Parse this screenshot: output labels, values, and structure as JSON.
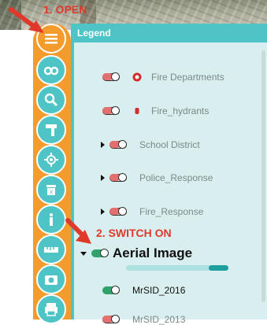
{
  "annotations": {
    "step1": "1. OPEN",
    "step2": "2. SWITCH ON"
  },
  "legend": {
    "title": "Legend",
    "layers": [
      {
        "label": "Fire Departments",
        "state": "off",
        "icon": "fire-dept-icon"
      },
      {
        "label": "Fire_hydrants",
        "state": "off",
        "icon": "hydrant-icon"
      },
      {
        "label": "School District",
        "state": "off",
        "expandable": true
      },
      {
        "label": "Police_Response",
        "state": "off",
        "expandable": true
      },
      {
        "label": "Fire_Response",
        "state": "off",
        "expandable": true
      }
    ],
    "aerial": {
      "label": "Aerial Image",
      "state": "on",
      "expanded": true,
      "opacity": 0.85
    },
    "sublayers": [
      {
        "label": "MrSID_2016",
        "state": "on"
      },
      {
        "label": "MrSID_2013",
        "state": "off"
      }
    ]
  },
  "toolbar": {
    "tools": [
      "menu-icon",
      "binoculars-icon",
      "search-icon",
      "hammer-icon",
      "locate-icon",
      "delete-icon",
      "info-icon",
      "ruler-icon",
      "camera-icon",
      "print-icon"
    ]
  },
  "colors": {
    "rail": "#f39b2c",
    "tool": "#4ec4c7",
    "panel": "#d9eeee",
    "annotation": "#e0392b",
    "toggle_on": "#2fa36b",
    "toggle_off": "#e46f6f"
  }
}
